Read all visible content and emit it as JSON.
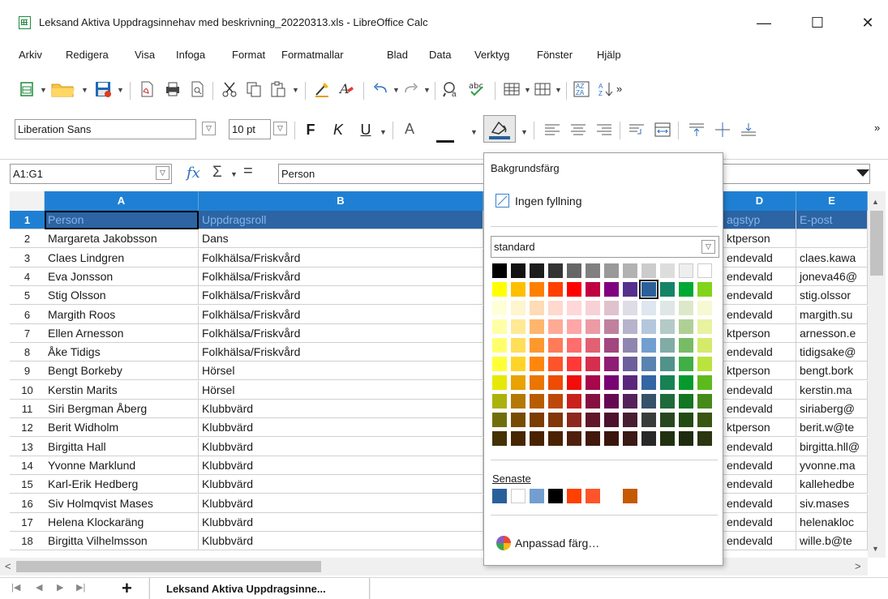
{
  "window": {
    "title": "Leksand Aktiva Uppdragsinnehav med beskrivning_20220313.xls - LibreOffice Calc",
    "minimize": "—",
    "maximize": "☐",
    "close": "✕"
  },
  "menu": [
    {
      "label": "Arkiv"
    },
    {
      "label": "Redigera"
    },
    {
      "label": "Visa"
    },
    {
      "label": "Infoga"
    },
    {
      "label": "Format"
    },
    {
      "label": "Formatmallar"
    },
    {
      "label": "Blad"
    },
    {
      "label": "Data"
    },
    {
      "label": "Verktyg"
    },
    {
      "label": "Fönster"
    },
    {
      "label": "Hjälp"
    }
  ],
  "format_toolbar": {
    "font_name": "Liberation Sans",
    "font_size": "10 pt",
    "bold": "F",
    "italic": "K",
    "underline": "U",
    "font_color_glyph": "A"
  },
  "formula_bar": {
    "name_box": "A1:G1",
    "fx": "fx",
    "sum": "Σ",
    "equals": "=",
    "content": "Person"
  },
  "columns": [
    {
      "label": "A"
    },
    {
      "label": "B"
    },
    {
      "label": "D"
    },
    {
      "label": "E"
    }
  ],
  "rows": [
    {
      "num": "1",
      "a": "Person",
      "b": "Uppdragsroll",
      "d": "agstyp",
      "e": "E-post"
    },
    {
      "num": "2",
      "a": "Margareta Jakobsson",
      "b": "Dans",
      "d": "ktperson",
      "e": ""
    },
    {
      "num": "3",
      "a": "Claes Lindgren",
      "b": "Folkhälsa/Friskvård",
      "d": "endevald",
      "e": "claes.kawa"
    },
    {
      "num": "4",
      "a": "Eva Jonsson",
      "b": "Folkhälsa/Friskvård",
      "d": "endevald",
      "e": "joneva46@"
    },
    {
      "num": "5",
      "a": "Stig Olsson",
      "b": "Folkhälsa/Friskvård",
      "d": "endevald",
      "e": "stig.olssor"
    },
    {
      "num": "6",
      "a": "Margith Roos",
      "b": "Folkhälsa/Friskvård",
      "d": "endevald",
      "e": "margith.su"
    },
    {
      "num": "7",
      "a": "Ellen Arnesson",
      "b": "Folkhälsa/Friskvård",
      "d": "ktperson",
      "e": "arnesson.e"
    },
    {
      "num": "8",
      "a": "Åke Tidigs",
      "b": "Folkhälsa/Friskvård",
      "d": "endevald",
      "e": "tidigsake@"
    },
    {
      "num": "9",
      "a": "Bengt Borkeby",
      "b": "Hörsel",
      "d": "ktperson",
      "e": "bengt.bork"
    },
    {
      "num": "10",
      "a": "Kerstin Marits",
      "b": "Hörsel",
      "d": "endevald",
      "e": "kerstin.ma"
    },
    {
      "num": "11",
      "a": "Siri Bergman Åberg",
      "b": "Klubbvärd",
      "d": "endevald",
      "e": "siriaberg@"
    },
    {
      "num": "12",
      "a": "Berit Widholm",
      "b": "Klubbvärd",
      "d": "ktperson",
      "e": "berit.w@te"
    },
    {
      "num": "13",
      "a": "Birgitta Hall",
      "b": "Klubbvärd",
      "d": "endevald",
      "e": "birgitta.hll@"
    },
    {
      "num": "14",
      "a": "Yvonne Marklund",
      "b": "Klubbvärd",
      "d": "endevald",
      "e": "yvonne.ma"
    },
    {
      "num": "15",
      "a": "Karl-Erik Hedberg",
      "b": "Klubbvärd",
      "d": "endevald",
      "e": "kallehedbe"
    },
    {
      "num": "16",
      "a": "Siv Holmqvist Mases",
      "b": "Klubbvärd",
      "d": "endevald",
      "e": "siv.mases"
    },
    {
      "num": "17",
      "a": "Helena Klockaräng",
      "b": "Klubbvärd",
      "d": "endevald",
      "e": "helenakloc"
    },
    {
      "num": "18",
      "a": "Birgitta Vilhelmsson",
      "b": "Klubbvärd",
      "d": "endevald",
      "e": "wille.b@te"
    }
  ],
  "color_popup": {
    "title": "Bakgrundsfärg",
    "no_fill": "Ingen fyllning",
    "palette": "standard",
    "recent_label": "Senaste",
    "custom": "Anpassad färg…",
    "colors": {
      "row0": [
        "#000000",
        "#111111",
        "#1c1c1c",
        "#333333",
        "#666666",
        "#808080",
        "#999999",
        "#b2b2b2",
        "#cccccc",
        "#dddddd",
        "#eeeeee",
        "#ffffff"
      ],
      "row1": [
        "#ffff00",
        "#ffbf00",
        "#ff8000",
        "#ff4000",
        "#ff0000",
        "#bf0041",
        "#800080",
        "#55308d",
        "#2a6099",
        "#158466",
        "#00a933",
        "#81d41a"
      ],
      "row2": [
        "#ffffd7",
        "#fff5ce",
        "#ffdbb6",
        "#ffd8ce",
        "#ffd7d7",
        "#f7d1d5",
        "#e0c2cd",
        "#dedce6",
        "#dee6ef",
        "#dee7e5",
        "#dde8cb",
        "#f6f9d4"
      ],
      "row3": [
        "#ffffa6",
        "#ffe994",
        "#ffb66c",
        "#ffaa95",
        "#ffa6a6",
        "#ec9ba4",
        "#bf819e",
        "#b7b3ca",
        "#b4c7dc",
        "#b3cac7",
        "#afd095",
        "#e8f2a1"
      ],
      "row4": [
        "#ffff6d",
        "#ffde59",
        "#ff972f",
        "#ff7b59",
        "#ff6d6d",
        "#e16173",
        "#a1467e",
        "#8e86ae",
        "#729fcf",
        "#81aca6",
        "#77bc65",
        "#d4ea6b"
      ],
      "row5": [
        "#ffff38",
        "#ffd428",
        "#ff860d",
        "#ff5429",
        "#ff3838",
        "#d62e4e",
        "#8d1d75",
        "#6b5e9b",
        "#5983b0",
        "#50938a",
        "#3faf46",
        "#bbe33d"
      ],
      "row6": [
        "#e6e905",
        "#e8a202",
        "#ea7500",
        "#ed4c05",
        "#f10d0c",
        "#a7074b",
        "#780373",
        "#5b277d",
        "#3465a4",
        "#168253",
        "#069a2e",
        "#5eb91e"
      ],
      "row7": [
        "#acb20c",
        "#b47804",
        "#b85c00",
        "#be480a",
        "#c9211e",
        "#861141",
        "#650953",
        "#55215b",
        "#355269",
        "#1e6a39",
        "#127622",
        "#468a1a"
      ],
      "row8": [
        "#706e0c",
        "#784b04",
        "#7b3d00",
        "#813709",
        "#8d281e",
        "#611729",
        "#4e102d",
        "#481d32",
        "#383d3c",
        "#28471f",
        "#224b12",
        "#395511"
      ],
      "row9": [
        "#443205",
        "#472702",
        "#492300",
        "#4b2204",
        "#50200c",
        "#41190d",
        "#3b160e",
        "#3a1a14",
        "#282828",
        "#213110",
        "#1f2b0e",
        "#2b3510"
      ],
      "recent": [
        "#2a6099",
        "#ffffff",
        "#729fcf",
        "#000000",
        "#ff4000",
        "#ff5429",
        "",
        "#c65a00"
      ]
    }
  },
  "sheet_tab": {
    "name": "Leksand Aktiva Uppdragsinne...",
    "add": "+"
  }
}
